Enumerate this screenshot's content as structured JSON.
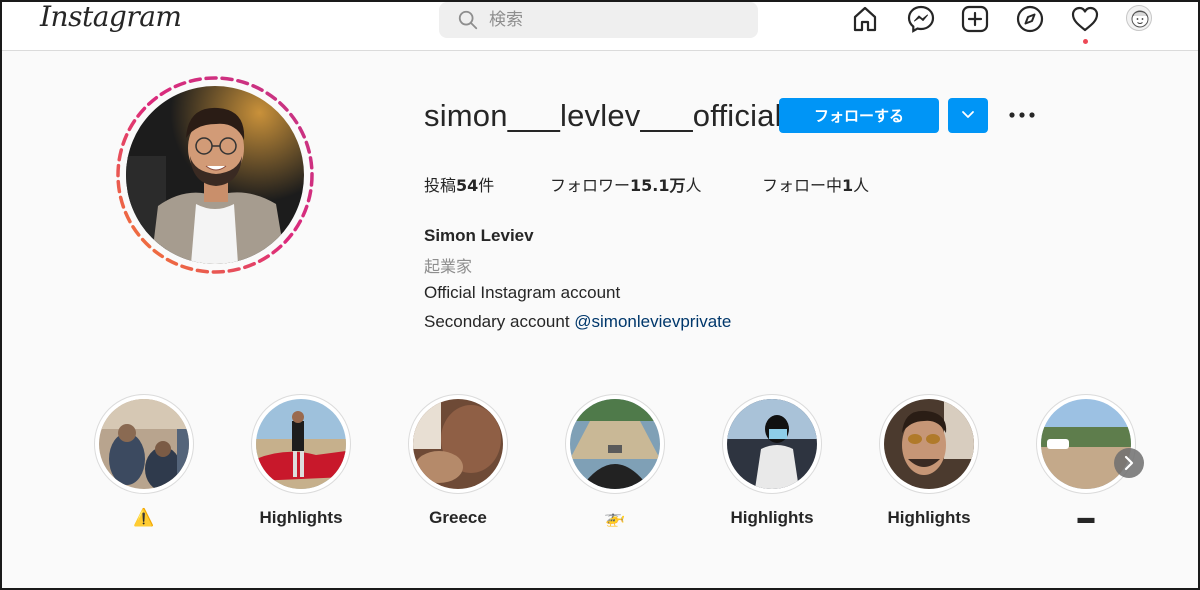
{
  "nav": {
    "logo_text": "Instagram",
    "search_placeholder": "検索",
    "icons": [
      "home-icon",
      "messenger-icon",
      "new-post-icon",
      "explore-icon",
      "activity-heart-icon",
      "profile-avatar-icon"
    ],
    "notification_dot_color": "#ed4956"
  },
  "profile": {
    "username": "simon___levlev___official",
    "follow_label": "フォローする",
    "stats": {
      "posts_prefix": "投稿",
      "posts_value": "54",
      "posts_suffix": "件",
      "followers_prefix": "フォロワー",
      "followers_value": "15.1万",
      "followers_suffix": "人",
      "following_prefix": "フォロー中",
      "following_value": "1",
      "following_suffix": "人"
    },
    "full_name": "Simon Leviev",
    "category": "起業家",
    "bio_line1": "Official Instagram account",
    "bio_line2_text": "Secondary account ",
    "bio_line2_link": "@simonlevievprivate"
  },
  "highlights": [
    {
      "label": "⚠️"
    },
    {
      "label": "Highlights"
    },
    {
      "label": "Greece"
    },
    {
      "label": "🚁"
    },
    {
      "label": "Highlights"
    },
    {
      "label": "Highlights"
    },
    {
      "label": "▬"
    }
  ],
  "colors": {
    "accent": "#0095f6",
    "link": "#00376b",
    "muted": "#8e8e8e",
    "story_ring_start": "#f58529",
    "story_ring_end": "#c13584"
  }
}
